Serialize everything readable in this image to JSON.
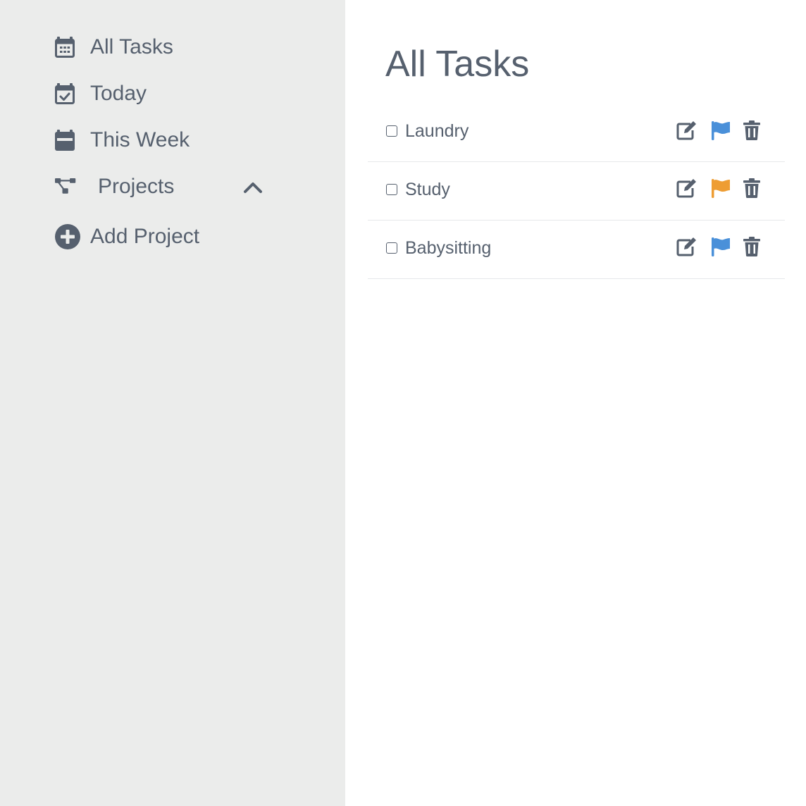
{
  "sidebar": {
    "items": [
      {
        "label": "All Tasks",
        "icon": "calendar-grid-icon"
      },
      {
        "label": "Today",
        "icon": "calendar-check-icon"
      },
      {
        "label": "This Week",
        "icon": "calendar-week-icon"
      },
      {
        "label": "Projects",
        "icon": "project-diagram-icon",
        "expanded": true,
        "toggle_icon": "chevron-up-icon"
      },
      {
        "label": "Add Project",
        "icon": "plus-circle-icon"
      }
    ]
  },
  "main": {
    "title": "All Tasks",
    "tasks": [
      {
        "name": "Laundry",
        "checked": false,
        "flag_color": "#4a90d9"
      },
      {
        "name": "Study",
        "checked": false,
        "flag_color": "#ee9d33"
      },
      {
        "name": "Babysitting",
        "checked": false,
        "flag_color": "#4a90d9"
      }
    ],
    "action_icons": [
      "edit-icon",
      "flag-icon",
      "trash-icon"
    ]
  },
  "colors": {
    "sidebar_bg": "#ebeceb",
    "text": "#56606e",
    "divider": "#e6e8ea",
    "flag_blue": "#4a90d9",
    "flag_orange": "#ee9d33"
  }
}
